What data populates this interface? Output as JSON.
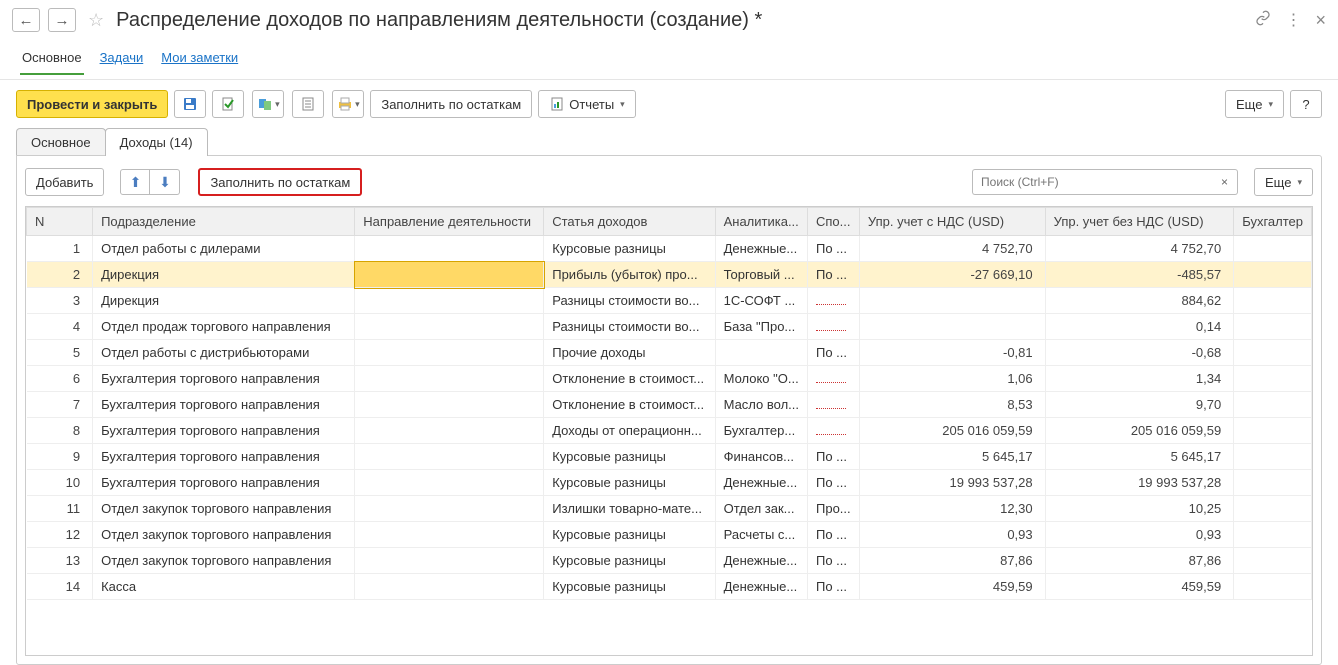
{
  "header": {
    "title": "Распределение доходов по направлениям деятельности (создание) *"
  },
  "topTabs": {
    "main": "Основное",
    "tasks": "Задачи",
    "notes": "Мои заметки"
  },
  "toolbar": {
    "postClose": "Провести и закрыть",
    "fillByBalance": "Заполнить по остаткам",
    "reports": "Отчеты",
    "more": "Еще",
    "help": "?"
  },
  "subTabs": {
    "main": "Основное",
    "income": "Доходы (14)"
  },
  "gridToolbar": {
    "add": "Добавить",
    "fillByBalance": "Заполнить по остаткам",
    "searchPlaceholder": "Поиск (Ctrl+F)",
    "clear": "×",
    "more": "Еще"
  },
  "columns": {
    "n": "N",
    "dept": "Подразделение",
    "dir": "Направление деятельности",
    "stat": "Статья доходов",
    "anal": "Аналитика...",
    "spo": "Спо...",
    "amt1": "Упр. учет с НДС (USD)",
    "amt2": "Упр. учет без НДС (USD)",
    "last": "Бухгалтер"
  },
  "rows": [
    {
      "n": "1",
      "dept": "Отдел работы с дилерами",
      "dir": "",
      "stat": "Курсовые разницы",
      "anal": "Денежные...",
      "spo": "По ...",
      "amt1": "4 752,70",
      "amt2": "4 752,70"
    },
    {
      "n": "2",
      "dept": "Дирекция",
      "dir": "",
      "stat": "Прибыль (убыток) про...",
      "anal": "Торговый ...",
      "spo": "По ...",
      "amt1": "-27 669,10",
      "amt2": "-485,57",
      "selected": true
    },
    {
      "n": "3",
      "dept": "Дирекция",
      "dir": "",
      "stat": "Разницы стоимости во...",
      "anal": "1С-СОФТ ...",
      "spo": "dots",
      "amt1": "",
      "amt2": "884,62"
    },
    {
      "n": "4",
      "dept": "Отдел продаж торгового направления",
      "dir": "",
      "stat": "Разницы стоимости во...",
      "anal": "База \"Про...",
      "spo": "dots",
      "amt1": "",
      "amt2": "0,14"
    },
    {
      "n": "5",
      "dept": "Отдел работы с дистрибьюторами",
      "dir": "",
      "stat": "Прочие доходы",
      "anal": "",
      "spo": "По ...",
      "amt1": "-0,81",
      "amt2": "-0,68"
    },
    {
      "n": "6",
      "dept": "Бухгалтерия торгового направления",
      "dir": "",
      "stat": "Отклонение в стоимост...",
      "anal": "Молоко \"О...",
      "spo": "dots",
      "amt1": "1,06",
      "amt2": "1,34"
    },
    {
      "n": "7",
      "dept": "Бухгалтерия торгового направления",
      "dir": "",
      "stat": "Отклонение в стоимост...",
      "anal": "Масло вол...",
      "spo": "dots",
      "amt1": "8,53",
      "amt2": "9,70"
    },
    {
      "n": "8",
      "dept": "Бухгалтерия торгового направления",
      "dir": "",
      "stat": "Доходы от операционн...",
      "anal": "Бухгалтер...",
      "spo": "dots",
      "amt1": "205 016 059,59",
      "amt2": "205 016 059,59"
    },
    {
      "n": "9",
      "dept": "Бухгалтерия торгового направления",
      "dir": "",
      "stat": "Курсовые разницы",
      "anal": "Финансов...",
      "spo": "По ...",
      "amt1": "5 645,17",
      "amt2": "5 645,17"
    },
    {
      "n": "10",
      "dept": "Бухгалтерия торгового направления",
      "dir": "",
      "stat": "Курсовые разницы",
      "anal": "Денежные...",
      "spo": "По ...",
      "amt1": "19 993 537,28",
      "amt2": "19 993 537,28"
    },
    {
      "n": "11",
      "dept": "Отдел закупок торгового направления",
      "dir": "",
      "stat": "Излишки товарно-мате...",
      "anal": "Отдел зак...",
      "spo": "Про...",
      "amt1": "12,30",
      "amt2": "10,25"
    },
    {
      "n": "12",
      "dept": "Отдел закупок торгового направления",
      "dir": "",
      "stat": "Курсовые разницы",
      "anal": "Расчеты с...",
      "spo": "По ...",
      "amt1": "0,93",
      "amt2": "0,93"
    },
    {
      "n": "13",
      "dept": "Отдел закупок торгового направления",
      "dir": "",
      "stat": "Курсовые разницы",
      "anal": "Денежные...",
      "spo": "По ...",
      "amt1": "87,86",
      "amt2": "87,86"
    },
    {
      "n": "14",
      "dept": "Касса",
      "dir": "",
      "stat": "Курсовые разницы",
      "anal": "Денежные...",
      "spo": "По ...",
      "amt1": "459,59",
      "amt2": "459,59"
    }
  ]
}
